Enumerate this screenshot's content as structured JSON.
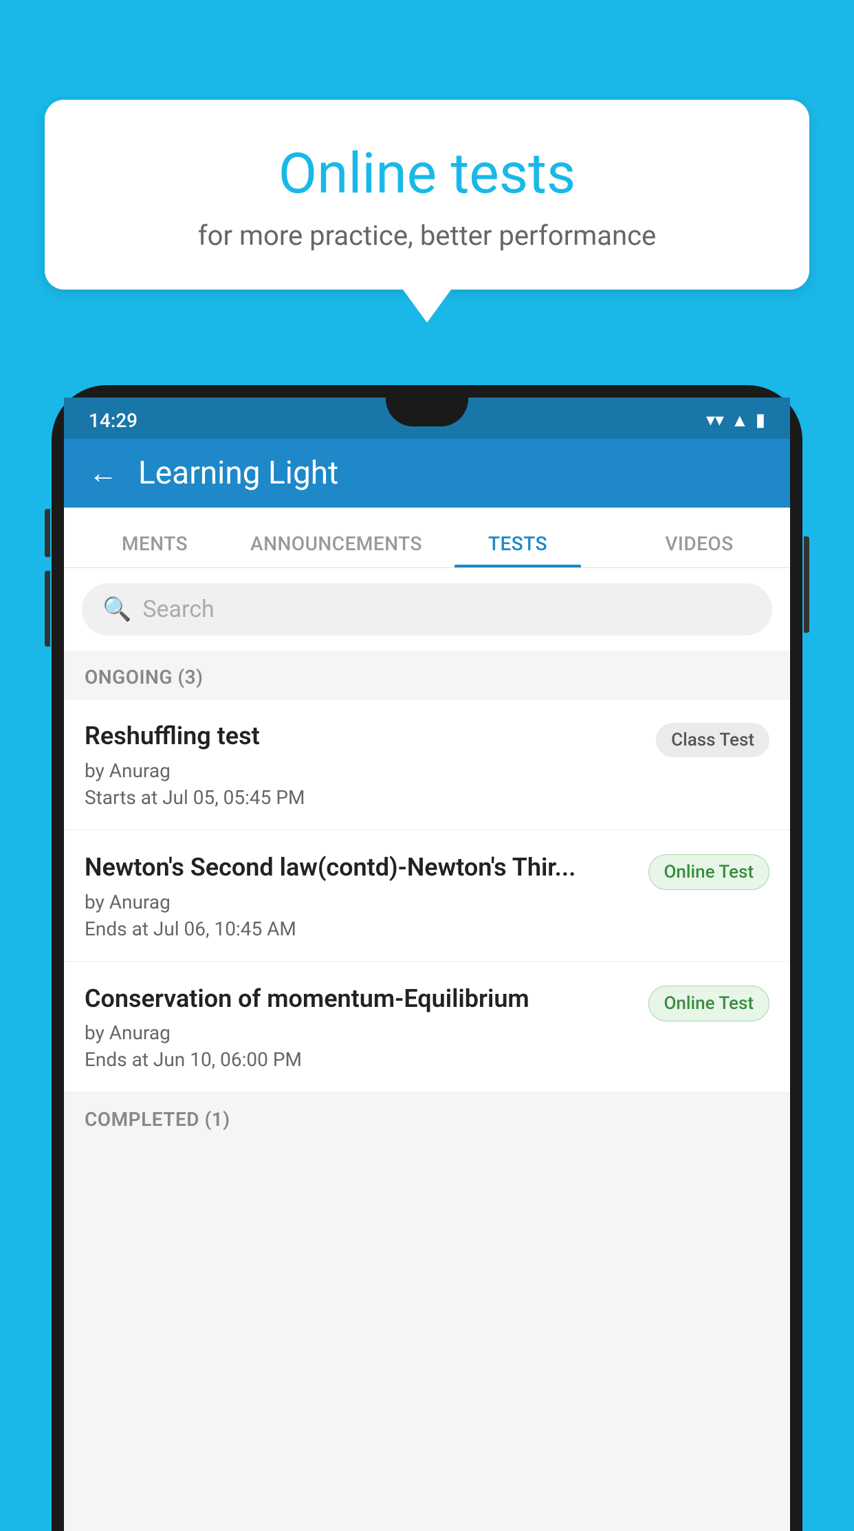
{
  "background": {
    "color": "#1ab8e8"
  },
  "speech_bubble": {
    "title": "Online tests",
    "subtitle": "for more practice, better performance"
  },
  "phone": {
    "status_bar": {
      "time": "14:29",
      "wifi_icon": "▼",
      "signal_icon": "▲",
      "battery_icon": "▮"
    },
    "header": {
      "back_label": "←",
      "title": "Learning Light"
    },
    "tabs": [
      {
        "label": "MENTS",
        "active": false
      },
      {
        "label": "ANNOUNCEMENTS",
        "active": false
      },
      {
        "label": "TESTS",
        "active": true
      },
      {
        "label": "VIDEOS",
        "active": false
      }
    ],
    "search": {
      "placeholder": "Search"
    },
    "ongoing_section": {
      "header": "ONGOING (3)",
      "items": [
        {
          "title": "Reshuffling test",
          "author": "by Anurag",
          "time_label": "Starts at",
          "time": "Jul 05, 05:45 PM",
          "badge": "Class Test",
          "badge_type": "class"
        },
        {
          "title": "Newton's Second law(contd)-Newton's Thir...",
          "author": "by Anurag",
          "time_label": "Ends at",
          "time": "Jul 06, 10:45 AM",
          "badge": "Online Test",
          "badge_type": "online"
        },
        {
          "title": "Conservation of momentum-Equilibrium",
          "author": "by Anurag",
          "time_label": "Ends at",
          "time": "Jun 10, 06:00 PM",
          "badge": "Online Test",
          "badge_type": "online"
        }
      ]
    },
    "completed_section": {
      "header": "COMPLETED (1)"
    }
  }
}
